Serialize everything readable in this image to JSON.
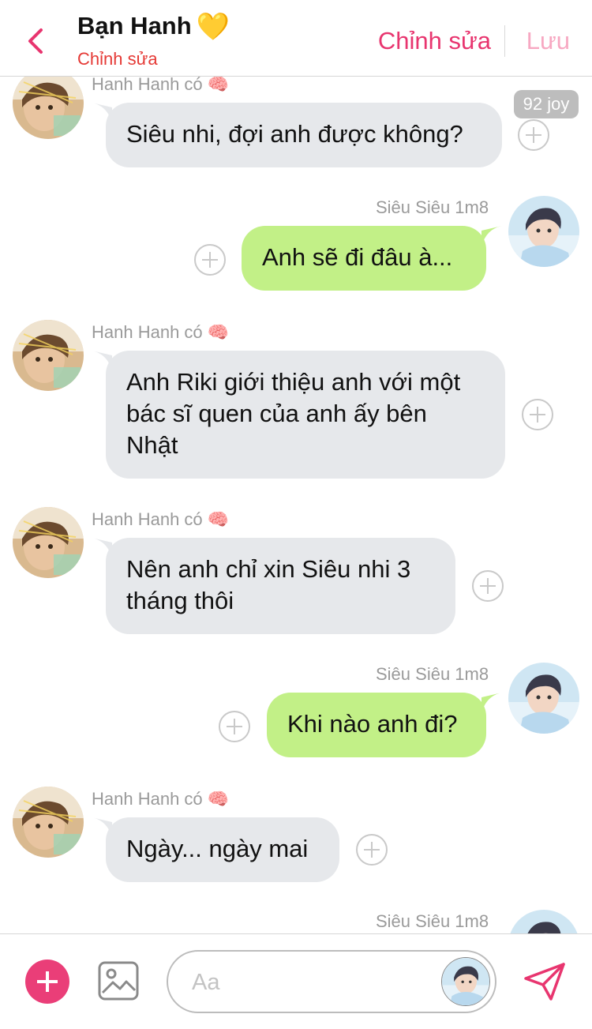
{
  "header": {
    "title": "Bạn Hanh",
    "title_emoji": "💛",
    "subtitle": "Chỉnh sửa",
    "edit_label": "Chỉnh sửa",
    "save_label": "Lưu"
  },
  "badge": {
    "joy": "92 joy"
  },
  "colors": {
    "accent": "#e8356f",
    "incoming_bubble": "#e6e8eb",
    "outgoing_bubble": "#c2f087",
    "subtitle_red": "#e53935"
  },
  "messages": [
    {
      "sender": "Hanh Hanh có",
      "sender_emoji": "🧠",
      "direction": "in",
      "text": "Siêu nhi, đợi anh được không?"
    },
    {
      "sender": "Siêu Siêu 1m8",
      "direction": "out",
      "text": "Anh sẽ đi đâu à..."
    },
    {
      "sender": "Hanh Hanh có",
      "sender_emoji": "🧠",
      "direction": "in",
      "lines": [
        "Anh Riki giới thiệu anh với một",
        "bác sĩ quen của anh ấy bên",
        "Nhật"
      ]
    },
    {
      "sender": "Hanh Hanh có",
      "sender_emoji": "🧠",
      "direction": "in",
      "lines": [
        "Nên anh chỉ xin Siêu nhi 3",
        "tháng thôi"
      ]
    },
    {
      "sender": "Siêu Siêu 1m8",
      "direction": "out",
      "text": "Khi nào anh đi?"
    },
    {
      "sender": "Hanh Hanh có",
      "sender_emoji": "🧠",
      "direction": "in",
      "text": "Ngày... ngày mai"
    },
    {
      "sender": "Siêu Siêu 1m8",
      "direction": "out"
    }
  ],
  "composer": {
    "placeholder": "Aa",
    "icons": {
      "add": "plus-icon",
      "image": "image-icon",
      "send": "send-icon"
    }
  }
}
